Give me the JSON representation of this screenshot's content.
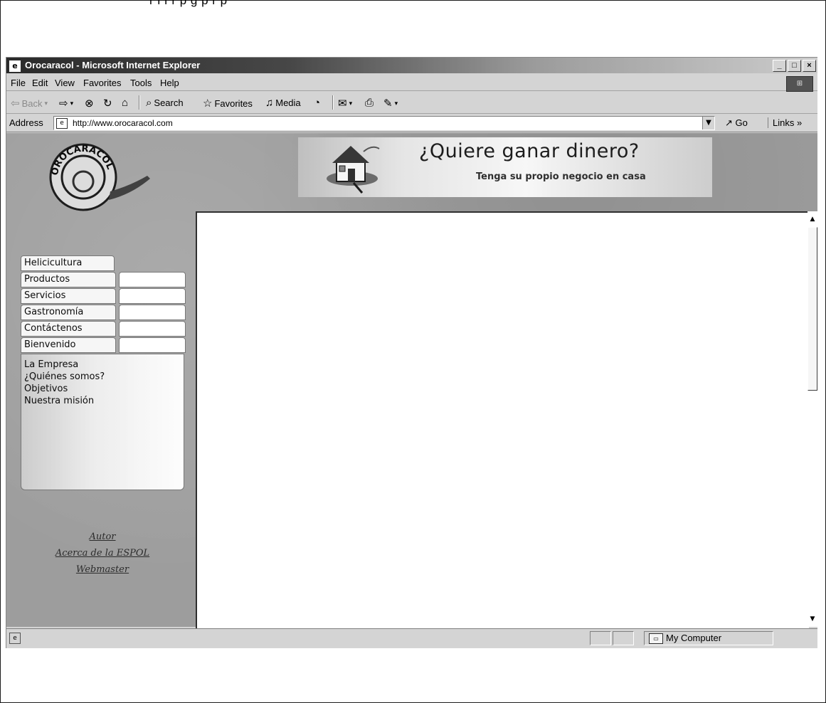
{
  "window": {
    "title": "Orocaracol - Microsoft Internet Explorer"
  },
  "menu": [
    "File",
    "Edit",
    "View",
    "Favorites",
    "Tools",
    "Help"
  ],
  "toolbar": {
    "back": "Back",
    "search": "Search",
    "favorites": "Favorites",
    "media": "Media"
  },
  "address": {
    "label": "Address",
    "url": "http://www.orocaracol.com",
    "go": "Go",
    "links": "Links »"
  },
  "logo": {
    "text": "OROCARACOL"
  },
  "banner": {
    "title": "¿Quiere ganar dinero?",
    "subtitle": "Tenga su propio negocio en casa"
  },
  "nav": {
    "tabs": [
      "Helicicultura",
      "Productos",
      "Servicios",
      "Gastronomía",
      "Contáctenos",
      "Bienvenido"
    ],
    "submenu": [
      "La Empresa",
      "¿Quiénes somos?",
      "Objetivos",
      "Nuestra misión"
    ]
  },
  "footer_links": [
    "Autor",
    "Acerca de la ESPOL",
    "Webmaster"
  ],
  "status": {
    "zone": "My Computer"
  },
  "icons": {
    "ie": "ie-icon",
    "minimize": "minimize-icon",
    "maximize": "maximize-icon",
    "close": "close-icon",
    "back": "back-arrow-icon",
    "forward": "forward-arrow-icon",
    "stop": "stop-icon",
    "refresh": "refresh-icon",
    "home": "home-icon",
    "search": "search-icon",
    "favorites": "favorites-icon",
    "media": "media-icon",
    "history": "history-icon",
    "mail": "mail-icon",
    "print": "print-icon",
    "edit": "edit-icon",
    "computer": "computer-icon"
  }
}
